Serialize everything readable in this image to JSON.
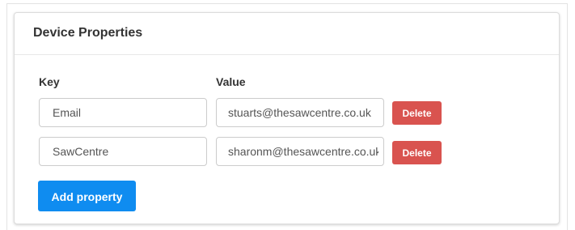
{
  "panel": {
    "title": "Device Properties"
  },
  "columns": {
    "key_label": "Key",
    "value_label": "Value"
  },
  "properties": [
    {
      "key": "Email",
      "value": "stuarts@thesawcentre.co.uk",
      "delete_label": "Delete"
    },
    {
      "key": "SawCentre",
      "value": "sharonm@thesawcentre.co.uk",
      "delete_label": "Delete"
    }
  ],
  "actions": {
    "add_label": "Add property"
  },
  "colors": {
    "delete_button": "#d9534f",
    "add_button": "#0f8cf0",
    "panel_border": "#dcdcdc"
  }
}
